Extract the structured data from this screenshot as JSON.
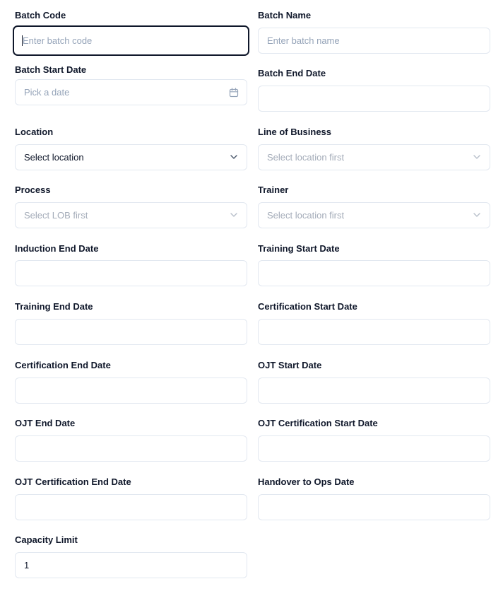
{
  "form": {
    "batch_code": {
      "label": "Batch Code",
      "placeholder": "Enter batch code",
      "value": ""
    },
    "batch_name": {
      "label": "Batch Name",
      "placeholder": "Enter batch name",
      "value": ""
    },
    "batch_start_date": {
      "label": "Batch Start Date",
      "placeholder": "Pick a date",
      "icon": "calendar-icon"
    },
    "batch_end_date": {
      "label": "Batch End Date",
      "value": ""
    },
    "location": {
      "label": "Location",
      "selected": "Select location",
      "icon": "chevron-down-icon"
    },
    "line_of_business": {
      "label": "Line of Business",
      "placeholder": "Select location first",
      "icon": "chevron-down-icon"
    },
    "process": {
      "label": "Process",
      "placeholder": "Select LOB first",
      "icon": "chevron-down-icon"
    },
    "trainer": {
      "label": "Trainer",
      "placeholder": "Select location first",
      "icon": "chevron-down-icon"
    },
    "induction_end_date": {
      "label": "Induction End Date",
      "value": ""
    },
    "training_start_date": {
      "label": "Training Start Date",
      "value": ""
    },
    "training_end_date": {
      "label": "Training End Date",
      "value": ""
    },
    "certification_start_date": {
      "label": "Certification Start Date",
      "value": ""
    },
    "certification_end_date": {
      "label": "Certification End Date",
      "value": ""
    },
    "ojt_start_date": {
      "label": "OJT Start Date",
      "value": ""
    },
    "ojt_end_date": {
      "label": "OJT End Date",
      "value": ""
    },
    "ojt_certification_start_date": {
      "label": "OJT Certification Start Date",
      "value": ""
    },
    "ojt_certification_end_date": {
      "label": "OJT Certification End Date",
      "value": ""
    },
    "handover_to_ops_date": {
      "label": "Handover to Ops Date",
      "value": ""
    },
    "capacity_limit": {
      "label": "Capacity Limit",
      "value": "1"
    }
  },
  "colors": {
    "text": "#0f172a",
    "placeholder": "#94a3b8",
    "border": "#e2e8f0",
    "focus_border": "#0f172a"
  }
}
